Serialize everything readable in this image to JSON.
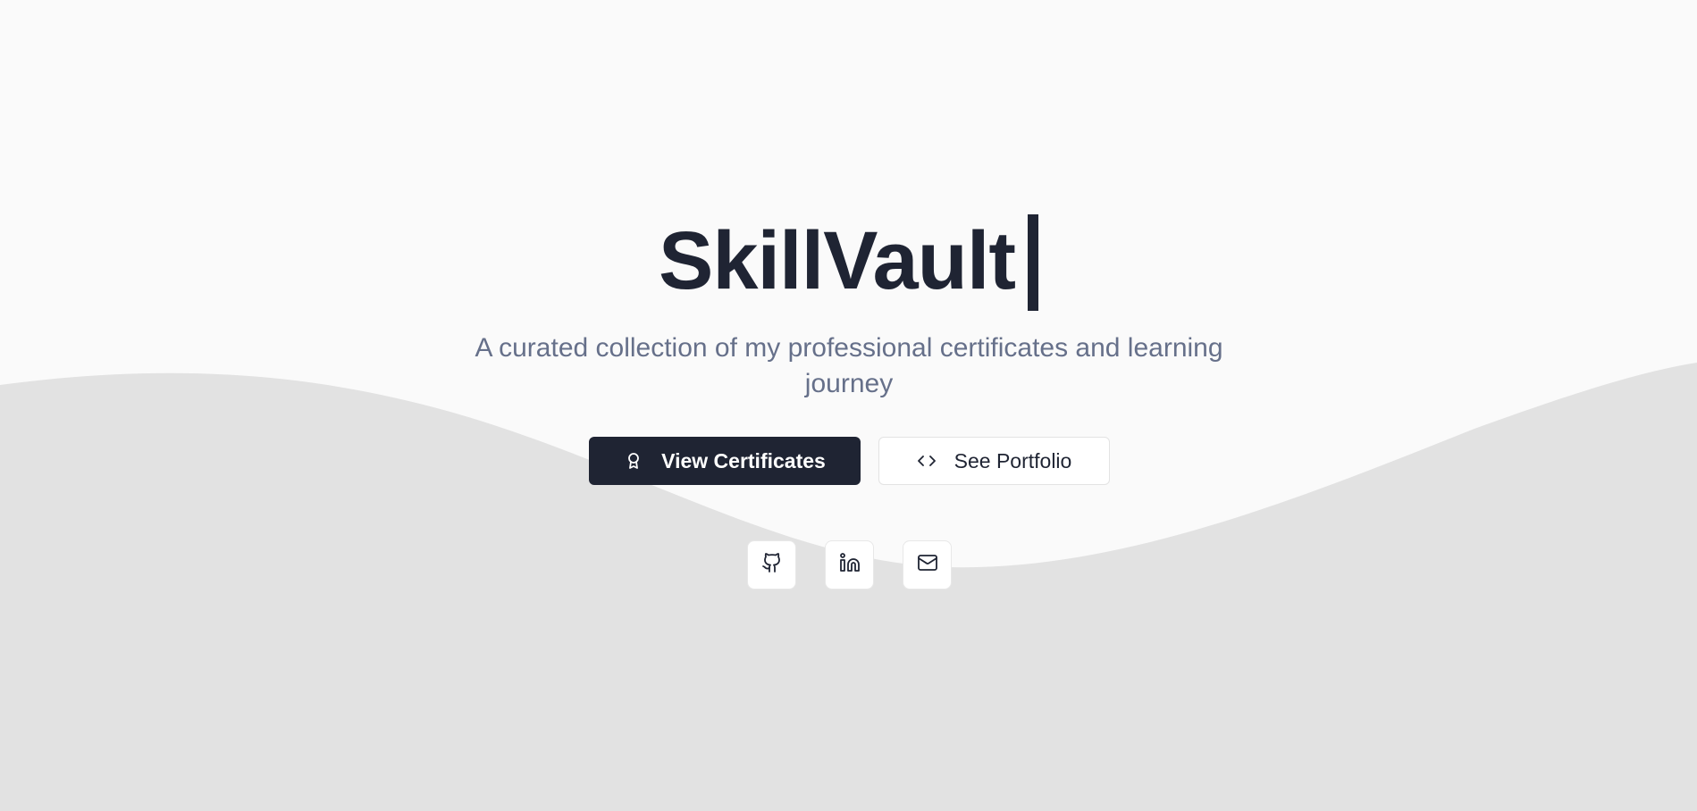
{
  "hero": {
    "title": "SkillVault",
    "subtitle": "A curated collection of my professional certificates and learning journey"
  },
  "buttons": {
    "primary_label": "View Certificates",
    "primary_icon": "award-icon",
    "secondary_label": "See Portfolio",
    "secondary_icon": "code-icon"
  },
  "social": [
    {
      "icon": "github-icon"
    },
    {
      "icon": "linkedin-icon"
    },
    {
      "icon": "mail-icon"
    }
  ],
  "colors": {
    "background": "#fafafa",
    "wave": "#e2e2e2",
    "primary": "#1f2433",
    "subtitle": "#66708a"
  }
}
